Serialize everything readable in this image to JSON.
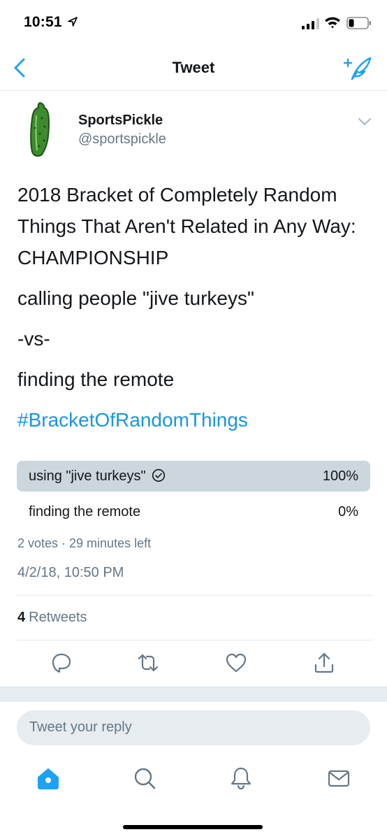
{
  "status_bar": {
    "time": "10:51"
  },
  "nav": {
    "title": "Tweet"
  },
  "tweet": {
    "display_name": "SportsPickle",
    "handle": "@sportspickle",
    "paragraphs": [
      "2018 Bracket of Completely Random Things That Aren't Related in Any Way: CHAMPIONSHIP",
      "calling people \"jive turkeys\"",
      "-vs-",
      "finding the remote"
    ],
    "hashtag": "#BracketOfRandomThings",
    "poll": {
      "options": [
        {
          "label": "using \"jive turkeys\"",
          "percent": "100%",
          "fraction": 1.0,
          "selected": true
        },
        {
          "label": "finding the remote",
          "percent": "0%",
          "fraction": 0.0,
          "selected": false
        }
      ],
      "meta": "2 votes · 29 minutes left"
    },
    "timestamp": "4/2/18, 10:50 PM",
    "retweet_count": "4",
    "retweet_label": "Retweets"
  },
  "reply": {
    "placeholder": "Tweet your reply"
  },
  "icons": {
    "back": "chevron-left-icon",
    "compose": "compose-tweet-icon",
    "caret": "chevron-down-icon",
    "reply": "reply-icon",
    "retweet": "retweet-icon",
    "like": "heart-icon",
    "share": "share-icon",
    "home": "home-icon",
    "search": "search-icon",
    "notifications": "bell-icon",
    "messages": "mail-icon"
  },
  "colors": {
    "accent": "#1da1f2",
    "link": "#1b95e0",
    "secondary_text": "#657786",
    "poll_fill": "#ccd6dd"
  }
}
